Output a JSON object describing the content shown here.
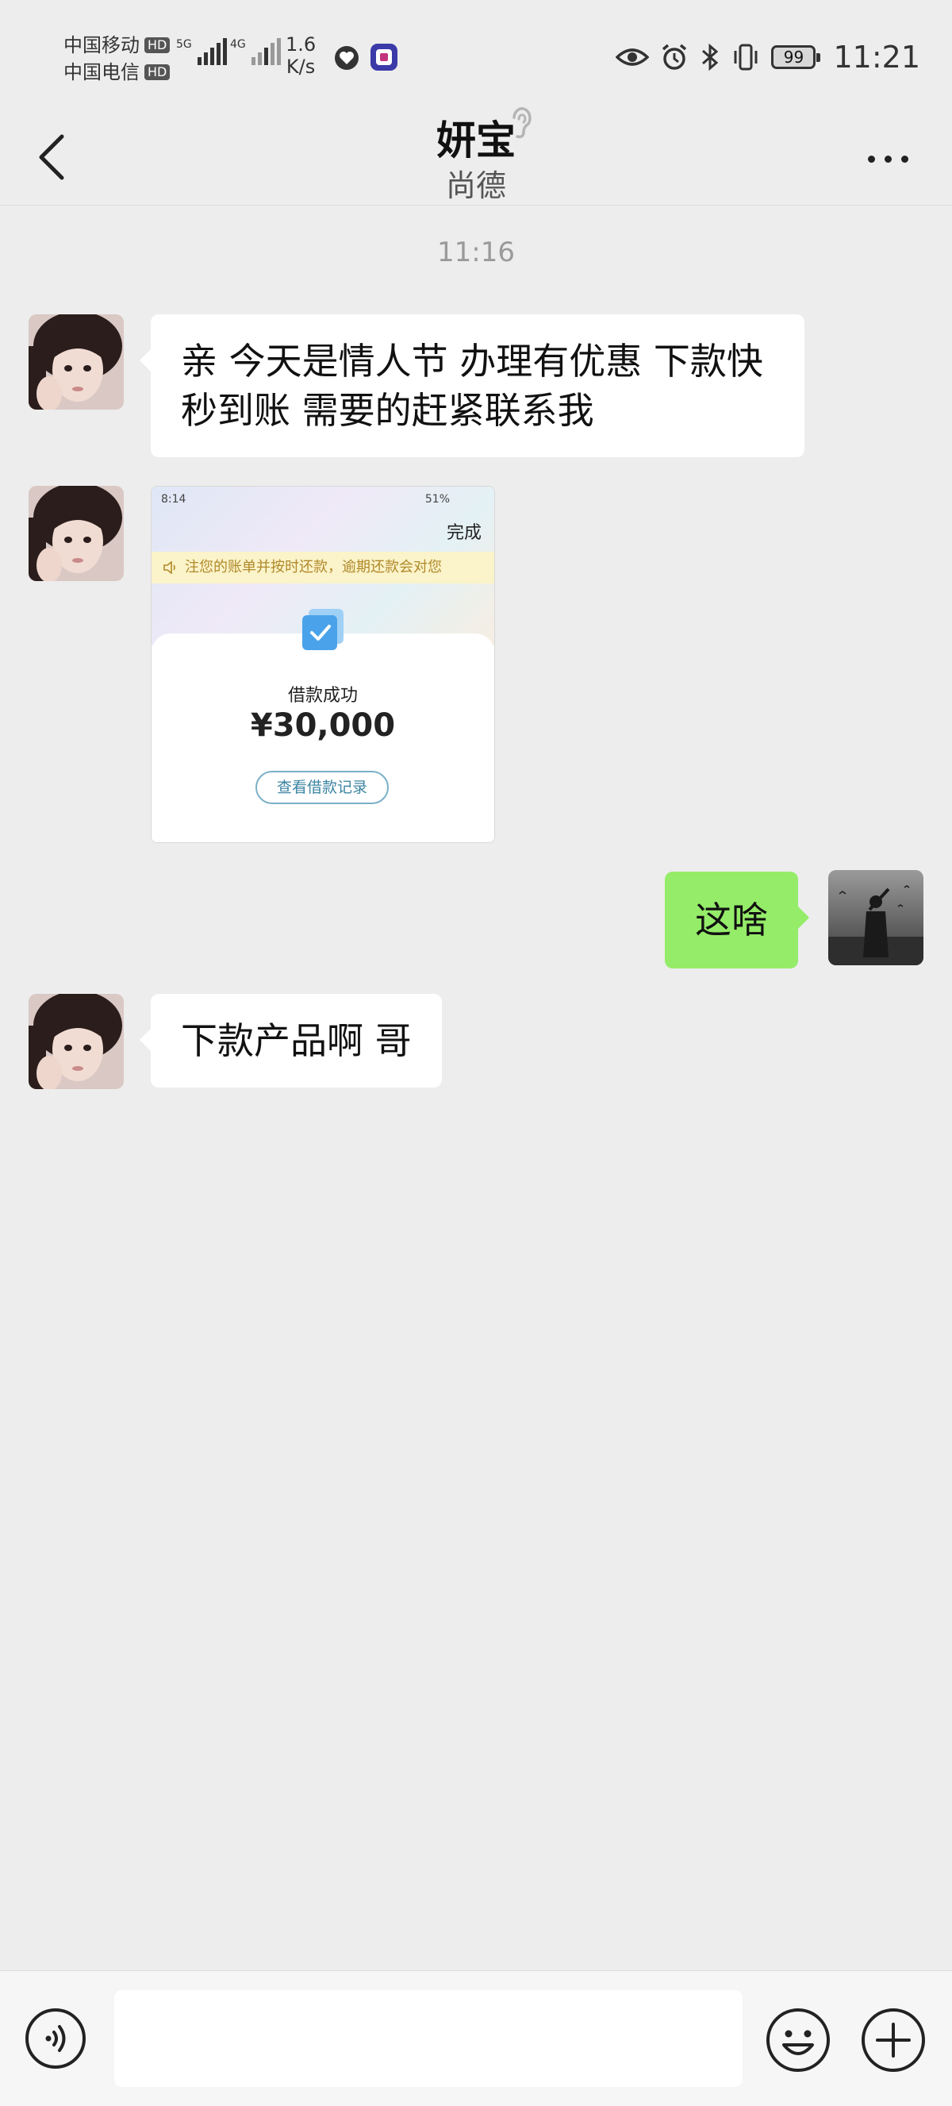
{
  "status_bar": {
    "carrier1": "中国移动",
    "carrier2": "中国电信",
    "hd": "HD",
    "net1": "5G",
    "net2": "4G",
    "speed_value": "1.6",
    "speed_unit": "K/s",
    "battery": "99",
    "time": "11:21",
    "icons": [
      "heart-app-icon",
      "sticker-app-icon",
      "eye-icon",
      "alarm-icon",
      "bluetooth-icon",
      "vibrate-icon",
      "battery-icon"
    ]
  },
  "header": {
    "title": "妍宝",
    "subtitle": "尚德",
    "icons": [
      "back-arrow-icon",
      "ear-icon",
      "more-icon"
    ]
  },
  "chat": {
    "time_separator": "11:16",
    "messages": [
      {
        "side": "left",
        "type": "text",
        "text": "亲  今天是情人节  办理有优惠  下款快秒到账 需要的赶紧联系我"
      },
      {
        "side": "left",
        "type": "image",
        "image": {
          "status_time": "8:14",
          "status_battery": "51%",
          "done": "完成",
          "notice": "注您的账单并按时还款，逾期还款会对您",
          "label": "借款成功",
          "amount": "¥30,000",
          "button": "查看借款记录"
        }
      },
      {
        "side": "right",
        "type": "text",
        "text": "这啥"
      },
      {
        "side": "left",
        "type": "text",
        "text": "下款产品啊 哥"
      }
    ]
  },
  "input_bar": {
    "value": "",
    "icons": [
      "voice-icon",
      "emoji-icon",
      "plus-icon"
    ]
  },
  "colors": {
    "background": "#ededed",
    "sent_bubble": "#95ec69",
    "received_bubble": "#ffffff"
  }
}
